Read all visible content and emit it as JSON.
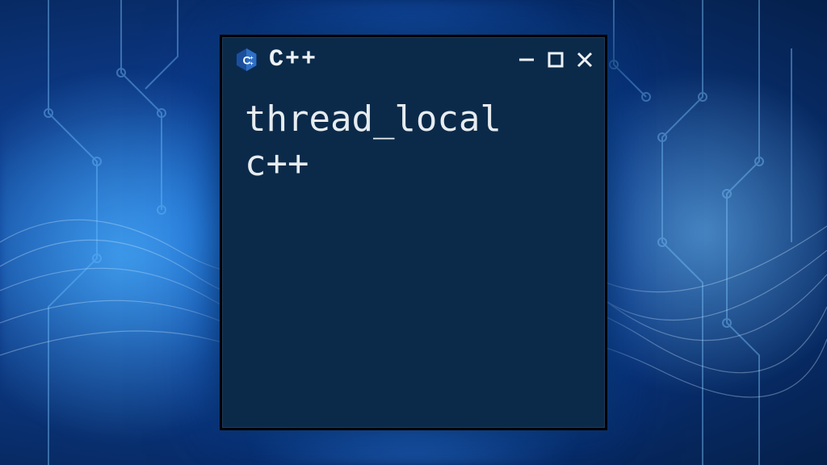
{
  "window": {
    "title": "C++",
    "icon_name": "cpp-hex-logo",
    "content_line1": "thread_local",
    "content_line2": "c++",
    "colors": {
      "window_bg": "#0b2a4a",
      "text": "#e7ecef",
      "border": "#000000",
      "accent_blue": "#1a6fd8"
    }
  }
}
